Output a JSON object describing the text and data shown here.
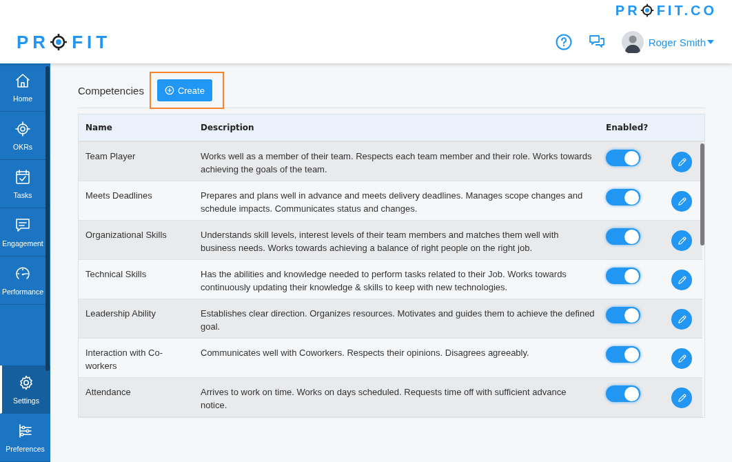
{
  "brand": {
    "top_logo": {
      "before": "PR",
      "after": "FIT.CO"
    },
    "logo": {
      "before": "PR",
      "after": "FIT"
    }
  },
  "header": {
    "user": "Roger Smith"
  },
  "sidebar": {
    "items": [
      {
        "label": "Home",
        "selected": false
      },
      {
        "label": "OKRs",
        "selected": false
      },
      {
        "label": "Tasks",
        "selected": false
      },
      {
        "label": "Engagement",
        "selected": false
      },
      {
        "label": "Performance",
        "selected": false
      },
      {
        "label": "Settings",
        "selected": true
      },
      {
        "label": "Preferences",
        "selected": false
      }
    ]
  },
  "page": {
    "title": "Competencies",
    "create_button": {
      "label": "Create",
      "highlighted": true
    }
  },
  "table": {
    "columns": [
      "Name",
      "Description",
      "Enabled?"
    ],
    "rows": [
      {
        "name": "Team Player",
        "description": "Works well as a member of their team. Respects each team member and their role. Works towards achieving the goals of the team.",
        "enabled": true
      },
      {
        "name": "Meets Deadlines",
        "description": "Prepares and plans well in advance and meets delivery deadlines. Manages scope changes and schedule impacts. Communicates status and changes.",
        "enabled": true
      },
      {
        "name": "Organizational Skills",
        "description": "Understands skill levels, interest levels of their team members and matches them well with business needs. Works towards achieving a balance of right people on the right job.",
        "enabled": true
      },
      {
        "name": "Technical Skills",
        "description": "Has the abilities and knowledge needed to perform tasks related to their Job. Works towards continuously updating their knowledge & skills to keep with new technologies.",
        "enabled": true
      },
      {
        "name": "Leadership Ability",
        "description": "Establishes clear direction. Organizes resources. Motivates and guides them to achieve the defined goal.",
        "enabled": true
      },
      {
        "name": "Interaction with Co-workers",
        "description": "Communicates well with Coworkers. Respects their opinions. Disagrees agreeably.",
        "enabled": true
      },
      {
        "name": "Attendance",
        "description": "Arrives to work on time. Works on days scheduled. Requests time off with sufficient advance notice.",
        "enabled": true
      }
    ]
  }
}
